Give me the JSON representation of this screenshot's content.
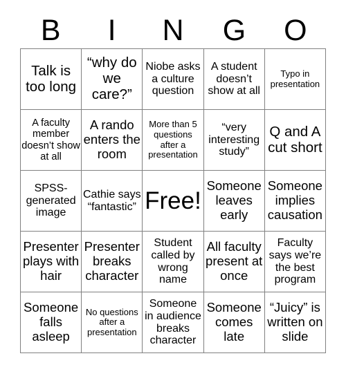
{
  "header": {
    "letters": [
      "B",
      "I",
      "N",
      "G",
      "O"
    ]
  },
  "grid": {
    "rows": [
      [
        {
          "text": "Talk is too long",
          "size": "xl"
        },
        {
          "text": "“why do we care?”",
          "size": "xl"
        },
        {
          "text": "Niobe asks a culture question",
          "size": "m"
        },
        {
          "text": "A student doesn’t show at all",
          "size": "m"
        },
        {
          "text": "Typo in presentation",
          "size": "xs"
        }
      ],
      [
        {
          "text": "A faculty member doesn’t show at all",
          "size": "s"
        },
        {
          "text": "A rando enters the room",
          "size": "l"
        },
        {
          "text": "More than 5 questions after a presentation",
          "size": "xs"
        },
        {
          "text": "“very interesting study”",
          "size": "m"
        },
        {
          "text": "Q and A cut short",
          "size": "xl"
        }
      ],
      [
        {
          "text": "SPSS-generated image",
          "size": "m"
        },
        {
          "text": "Cathie says “fantastic”",
          "size": "m"
        },
        {
          "text": "Free!",
          "size": "free"
        },
        {
          "text": "Someone leaves early",
          "size": "l"
        },
        {
          "text": "Someone implies causation",
          "size": "l"
        }
      ],
      [
        {
          "text": "Presenter plays with hair",
          "size": "l"
        },
        {
          "text": "Presenter breaks character",
          "size": "l"
        },
        {
          "text": "Student called by wrong name",
          "size": "m"
        },
        {
          "text": "All faculty present at once",
          "size": "l"
        },
        {
          "text": "Faculty says we’re the best program",
          "size": "m"
        }
      ],
      [
        {
          "text": "Someone falls asleep",
          "size": "l"
        },
        {
          "text": "No questions after a presentation",
          "size": "xs"
        },
        {
          "text": "Someone in audience breaks character",
          "size": "m"
        },
        {
          "text": "Someone comes late",
          "size": "l"
        },
        {
          "text": "“Juicy” is written on slide",
          "size": "l"
        }
      ]
    ]
  },
  "colors": {
    "background": "#ffffff",
    "text": "#000000",
    "grid_line": "#808080"
  }
}
